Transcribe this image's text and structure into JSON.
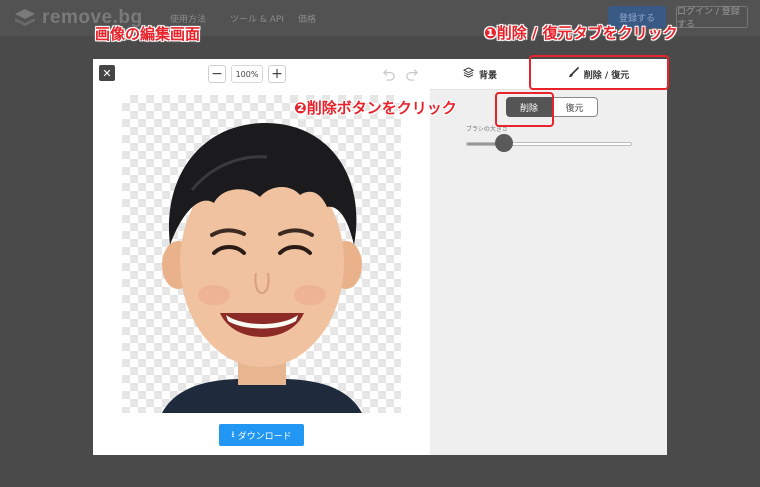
{
  "header": {
    "logo_text": "remove.bg",
    "nav": [
      "使用方法",
      "ツール & API",
      "価格"
    ],
    "signup_label": "登録する",
    "login_label": "ログイン / 登録する"
  },
  "annotations": {
    "edit_screen": "画像の編集画面",
    "step1": "❶削除 / 復元タブをクリック",
    "step2": "❷削除ボタンをクリック"
  },
  "editor": {
    "zoom": {
      "minus": "−",
      "value": "100%",
      "plus": "+"
    },
    "close_label": "✕",
    "undo_icon": "undo-icon",
    "redo_icon": "redo-icon",
    "download_label": "ダウンロード",
    "tabs": {
      "background": "背景",
      "erase_restore": "削除 / 復元"
    },
    "mode": {
      "erase": "削除",
      "restore": "復元",
      "active": "erase"
    },
    "brush_size_label": "ブラシの大きさ",
    "brush_size_fraction": 0.23
  },
  "colors": {
    "accent": "#2196f3",
    "highlight": "#e8232b",
    "active_button": "#555555"
  }
}
